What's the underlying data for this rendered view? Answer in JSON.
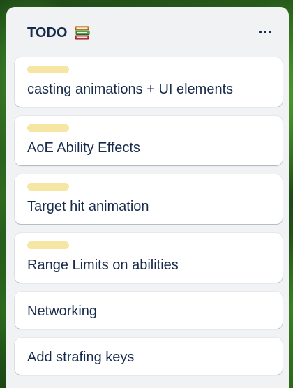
{
  "list": {
    "title": "TODO",
    "title_icon": "books-icon",
    "menu_icon": "more-horizontal-icon",
    "cards": [
      {
        "title": "casting animations + UI elements",
        "label_color": "#f5e6a3",
        "has_label": true
      },
      {
        "title": "AoE Ability Effects",
        "label_color": "#f5e6a3",
        "has_label": true
      },
      {
        "title": "Target hit animation",
        "label_color": "#f5e6a3",
        "has_label": true
      },
      {
        "title": "Range Limits on abilities",
        "label_color": "#f5e6a3",
        "has_label": true
      },
      {
        "title": "Networking",
        "has_label": false
      },
      {
        "title": "Add strafing keys",
        "has_label": false
      }
    ]
  },
  "colors": {
    "list_background": "#f1f2f4",
    "card_background": "#ffffff",
    "text": "#172b4d",
    "label_yellow": "#f5e6a3"
  }
}
